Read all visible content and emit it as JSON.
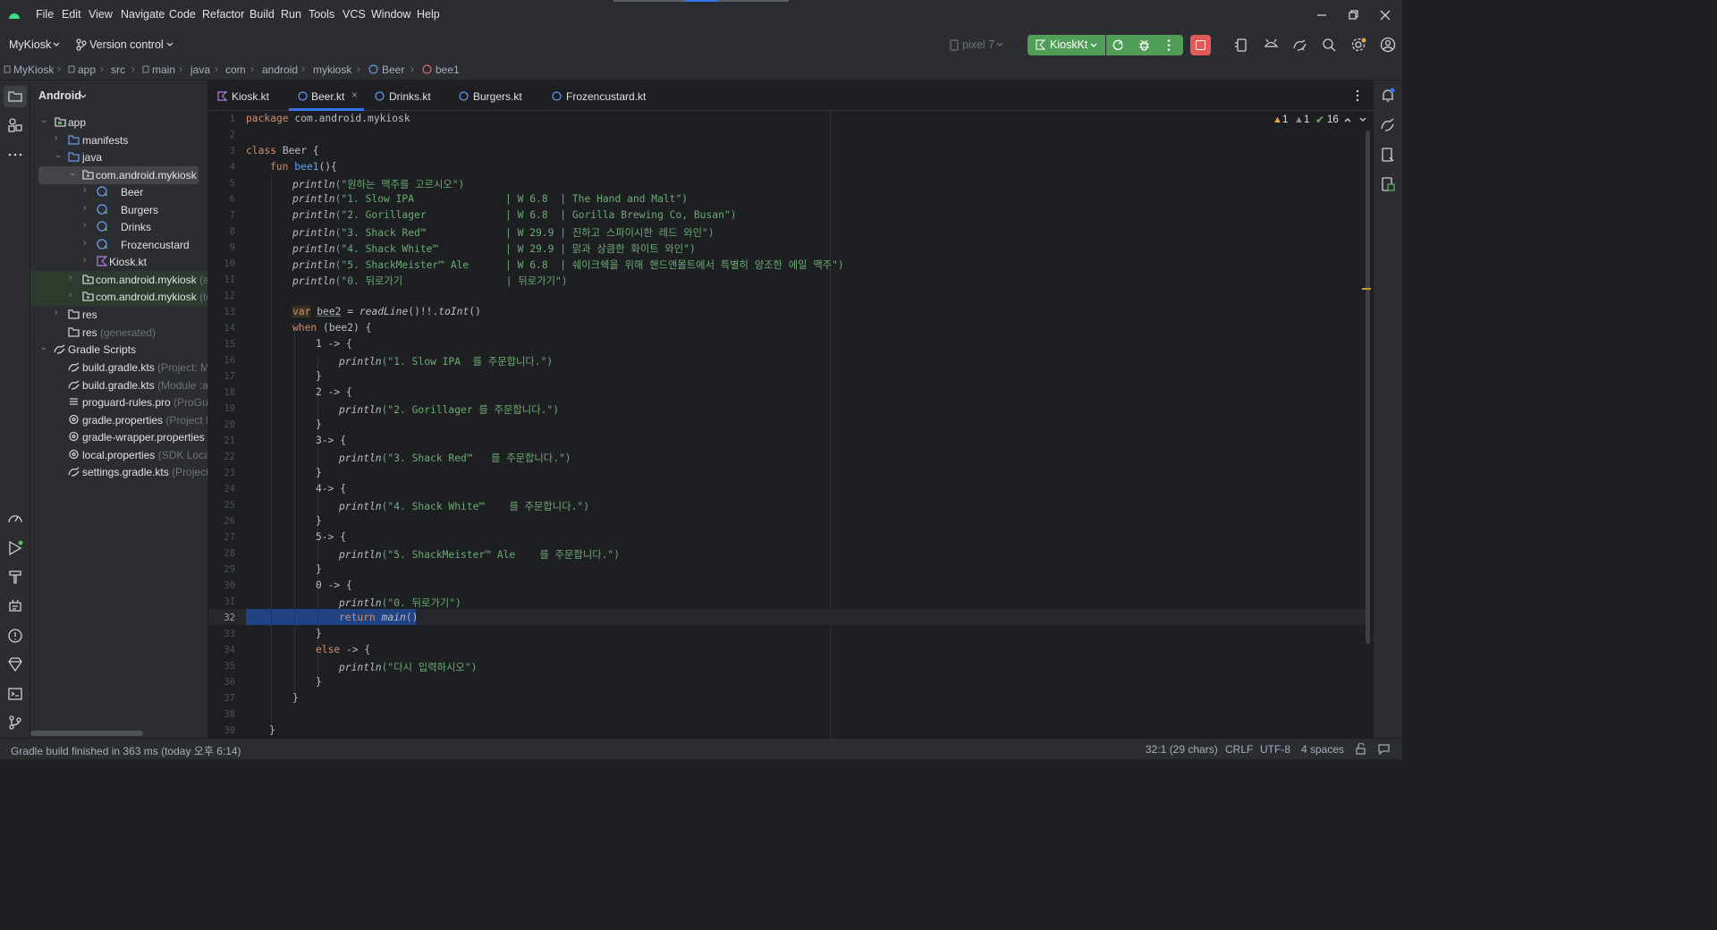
{
  "menu": [
    "File",
    "Edit",
    "View",
    "Navigate",
    "Code",
    "Refactor",
    "Build",
    "Run",
    "Tools",
    "VCS",
    "Window",
    "Help"
  ],
  "toolbar": {
    "project": "MyKiosk",
    "vcs": "Version control",
    "device": "pixel 7",
    "run_config": "KioskKt"
  },
  "breadcrumbs": [
    "MyKiosk",
    "app",
    "src",
    "main",
    "java",
    "com",
    "android",
    "mykiosk",
    "Beer",
    "bee1"
  ],
  "project_view": {
    "title": "Android",
    "items": [
      {
        "label": "app",
        "hint": ""
      },
      {
        "label": "manifests",
        "hint": ""
      },
      {
        "label": "java",
        "hint": ""
      },
      {
        "label": "com.android.mykiosk",
        "hint": ""
      },
      {
        "label": "Beer",
        "hint": ""
      },
      {
        "label": "Burgers",
        "hint": ""
      },
      {
        "label": "Drinks",
        "hint": ""
      },
      {
        "label": "Frozencustard",
        "hint": ""
      },
      {
        "label": "Kiosk.kt",
        "hint": ""
      },
      {
        "label": "com.android.mykiosk",
        "hint": "(an"
      },
      {
        "label": "com.android.mykiosk",
        "hint": "(te"
      },
      {
        "label": "res",
        "hint": ""
      },
      {
        "label": "res",
        "hint": "(generated)"
      },
      {
        "label": "Gradle Scripts",
        "hint": ""
      },
      {
        "label": "build.gradle.kts",
        "hint": "(Project: My"
      },
      {
        "label": "build.gradle.kts",
        "hint": "(Module :ap"
      },
      {
        "label": "proguard-rules.pro",
        "hint": "(ProGua"
      },
      {
        "label": "gradle.properties",
        "hint": "(Project P"
      },
      {
        "label": "gradle-wrapper.properties",
        "hint": "("
      },
      {
        "label": "local.properties",
        "hint": "(SDK Locati"
      },
      {
        "label": "settings.gradle.kts",
        "hint": "(Project"
      }
    ]
  },
  "tabs": [
    "Kiosk.kt",
    "Beer.kt",
    "Drinks.kt",
    "Burgers.kt",
    "Frozencustard.kt"
  ],
  "inspections": {
    "warnings": "1",
    "weak": "1",
    "ok": "16"
  },
  "line_numbers": [
    "1",
    "2",
    "3",
    "4",
    "5",
    "6",
    "7",
    "8",
    "9",
    "10",
    "11",
    "12",
    "13",
    "14",
    "15",
    "16",
    "17",
    "18",
    "19",
    "20",
    "21",
    "22",
    "23",
    "24",
    "25",
    "26",
    "27",
    "28",
    "29",
    "30",
    "31",
    "32",
    "33",
    "34",
    "35",
    "36",
    "37",
    "38",
    "39"
  ],
  "code": {
    "l1_kw": "package",
    "l1_rest": " com.android.mykiosk",
    "l3_kw": "class",
    "l3_rest": " Beer {",
    "l4_kw": "fun",
    "l4_fn": "bee1",
    "l4_rest": "(){",
    "l5_fn": "println",
    "l5_str": "(\"원하는 맥주를 고르시오\")",
    "l6_str": "(\"1. Slow IPA               | W 6.8  | The Hand and Malt\")",
    "l7_str": "(\"2. Gorillager             | W 6.8  | Gorilla Brewing Co, Busan\")",
    "l8_str": "(\"3. Shack Red™             | W 29.9 | 진하고 스파이시한 레드 와인\")",
    "l9_str": "(\"4. Shack White™           | W 29.9 | 맑과 상큼한 화이트 와인\")",
    "l10_str": "(\"5. ShackMeister™ Ale      | W 6.8  | 쉐이크쉑을 위해 핸드앤몰트에서 특별히 양조한 에일 맥주\")",
    "l11_str": "(\"0. 뒤로가기                 | 뒤로가기\")",
    "l13_kw": "var",
    "l13_var": "bee2",
    "l13_mid": " = ",
    "l13_call": "readLine",
    "l13_mid2": "()!!.",
    "l13_call2": "toInt",
    "l13_end": "()",
    "l14_kw": "when",
    "l14_rest": " (bee2) {",
    "l15": "1 -> {",
    "l16_str": "(\"1. Slow IPA  를 주문합니다.\")",
    "l17": "}",
    "l18": "2 -> {",
    "l19_str": "(\"2. Gorillager 를 주문합니다.\")",
    "l21": "3-> {",
    "l22_str": "(\"3. Shack Red™   를 주문합니다.\")",
    "l24": "4-> {",
    "l25_str": "(\"4. Shack White™    를 주문합니다.\")",
    "l27": "5-> {",
    "l28_str": "(\"5. ShackMeister™ Ale    를 주문합니다.\")",
    "l30": "0 -> {",
    "l31_str": "(\"0. 뒤로가기\")",
    "l32_kw": "return",
    "l32_call": "main",
    "l32_end": "()",
    "l34_kw": "else",
    "l34_rest": " -> {",
    "l35_str": "(\"다시 입력하시오\")"
  },
  "status": {
    "message": "Gradle build finished in 363 ms (today 오후 6:14)",
    "position": "32:1 (29 chars)",
    "line_sep": "CRLF",
    "encoding": "UTF-8",
    "indent": "4 spaces"
  },
  "colors": {
    "run_button": "#4f9d57",
    "stop_button": "#e05a5a",
    "selection": "#214283",
    "keyword": "#cf8e6d",
    "string": "#6aab73",
    "function": "#56a8f5"
  }
}
